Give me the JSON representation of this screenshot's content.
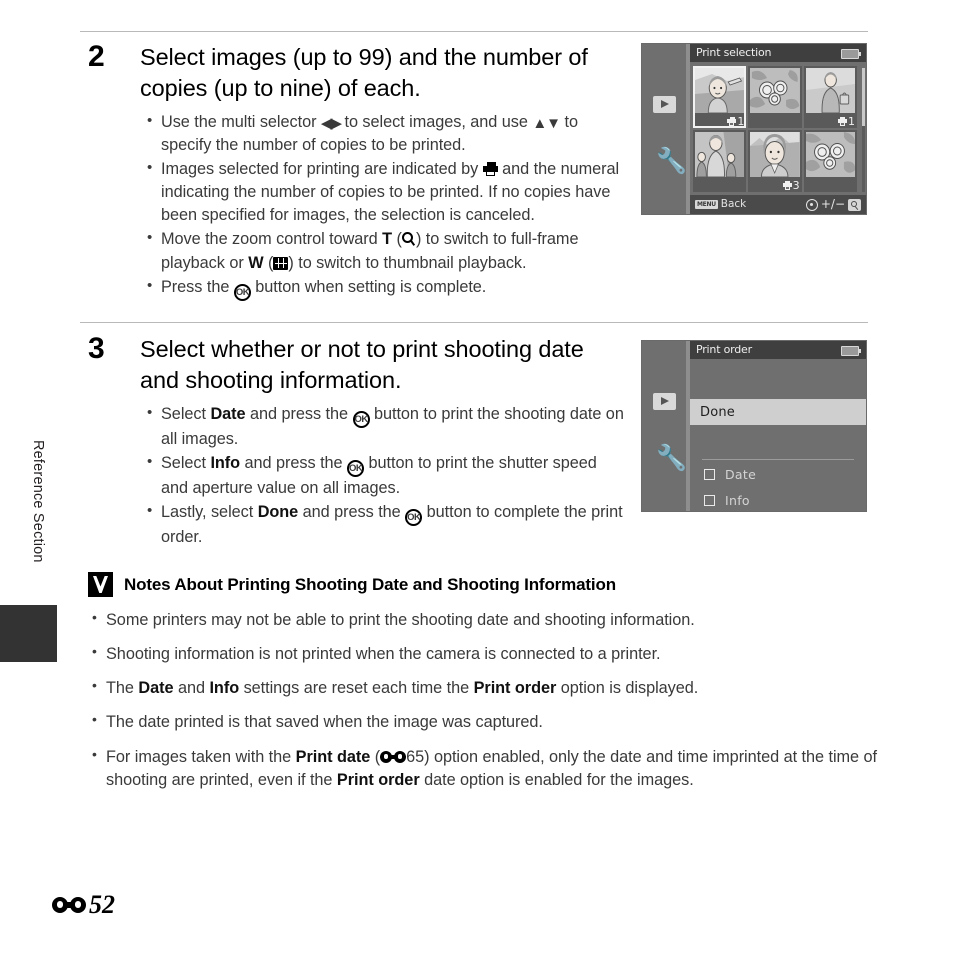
{
  "page": {
    "side_label": "Reference Section",
    "footer_page": "52"
  },
  "steps": [
    {
      "number": "2",
      "title": "Select images (up to 99) and the number of copies (up to nine) of each.",
      "bullets": [
        {
          "parts": [
            {
              "t": "text",
              "v": "Use the multi selector "
            },
            {
              "t": "icon",
              "v": "left-right-arrows-icon"
            },
            {
              "t": "text",
              "v": " to select images, and use "
            },
            {
              "t": "icon",
              "v": "up-down-arrows-icon"
            },
            {
              "t": "text",
              "v": " to specify the number of copies to be printed."
            }
          ]
        },
        {
          "parts": [
            {
              "t": "text",
              "v": "Images selected for printing are indicated by "
            },
            {
              "t": "icon",
              "v": "printer-icon"
            },
            {
              "t": "text",
              "v": " and the numeral indicating the number of copies to be printed. If no copies have been specified for images, the selection is canceled."
            }
          ]
        },
        {
          "parts": [
            {
              "t": "text",
              "v": "Move the zoom control toward "
            },
            {
              "t": "bold",
              "v": "T"
            },
            {
              "t": "text",
              "v": " ("
            },
            {
              "t": "icon",
              "v": "magnifier-icon"
            },
            {
              "t": "text",
              "v": ") to switch to full-frame playback or "
            },
            {
              "t": "bold",
              "v": "W"
            },
            {
              "t": "text",
              "v": " ("
            },
            {
              "t": "icon",
              "v": "thumbnail-grid-icon"
            },
            {
              "t": "text",
              "v": ") to switch to thumbnail playback."
            }
          ]
        },
        {
          "parts": [
            {
              "t": "text",
              "v": "Press the "
            },
            {
              "t": "icon",
              "v": "ok-button-icon"
            },
            {
              "t": "text",
              "v": " button when setting is complete."
            }
          ]
        }
      ]
    },
    {
      "number": "3",
      "title": "Select whether or not to print shooting date and shooting information.",
      "bullets": [
        {
          "parts": [
            {
              "t": "text",
              "v": "Select "
            },
            {
              "t": "bold",
              "v": "Date"
            },
            {
              "t": "text",
              "v": " and press the "
            },
            {
              "t": "icon",
              "v": "ok-button-icon"
            },
            {
              "t": "text",
              "v": " button to print the shooting date on all images."
            }
          ]
        },
        {
          "parts": [
            {
              "t": "text",
              "v": "Select "
            },
            {
              "t": "bold",
              "v": "Info"
            },
            {
              "t": "text",
              "v": " and press the "
            },
            {
              "t": "icon",
              "v": "ok-button-icon"
            },
            {
              "t": "text",
              "v": " button to print the shutter speed and aperture value on all images."
            }
          ]
        },
        {
          "parts": [
            {
              "t": "text",
              "v": "Lastly, select "
            },
            {
              "t": "bold",
              "v": "Done"
            },
            {
              "t": "text",
              "v": " and press the "
            },
            {
              "t": "icon",
              "v": "ok-button-icon"
            },
            {
              "t": "text",
              "v": " button to complete the print order."
            }
          ]
        }
      ]
    }
  ],
  "notes": {
    "icon": "warning-checkmark-icon",
    "title": "Notes About Printing Shooting Date and Shooting Information",
    "items": [
      {
        "parts": [
          {
            "t": "text",
            "v": "Some printers may not be able to print the shooting date and shooting information."
          }
        ]
      },
      {
        "parts": [
          {
            "t": "text",
            "v": "Shooting information is not printed when the camera is connected to a printer."
          }
        ]
      },
      {
        "parts": [
          {
            "t": "text",
            "v": "The "
          },
          {
            "t": "bold",
            "v": "Date"
          },
          {
            "t": "text",
            "v": " and "
          },
          {
            "t": "bold",
            "v": "Info"
          },
          {
            "t": "text",
            "v": " settings are reset each time the "
          },
          {
            "t": "bold",
            "v": "Print order"
          },
          {
            "t": "text",
            "v": " option is displayed."
          }
        ]
      },
      {
        "parts": [
          {
            "t": "text",
            "v": "The date printed is that saved when the image was captured."
          }
        ]
      },
      {
        "parts": [
          {
            "t": "text",
            "v": "For images taken with the "
          },
          {
            "t": "bold",
            "v": "Print date"
          },
          {
            "t": "text",
            "v": " ("
          },
          {
            "t": "icon",
            "v": "reference-section-icon"
          },
          {
            "t": "text",
            "v": "65) option enabled, only the date and time imprinted at the time of shooting are printed, even if the "
          },
          {
            "t": "bold",
            "v": "Print order"
          },
          {
            "t": "text",
            "v": " date option is enabled for the images."
          }
        ]
      }
    ]
  },
  "screens": {
    "print_selection": {
      "title": "Print selection",
      "battery_icon": "battery-icon",
      "rail": {
        "playback_icon": "playback-mode-icon",
        "setup_icon": "wrench-setup-icon"
      },
      "thumbnails": [
        {
          "id": 1,
          "selected": true,
          "count": "1",
          "scene": "woman-beach"
        },
        {
          "id": 2,
          "selected": false,
          "count": "",
          "scene": "flowers"
        },
        {
          "id": 3,
          "selected": false,
          "count": "1",
          "scene": "woman-bag"
        },
        {
          "id": 4,
          "selected": false,
          "count": "",
          "scene": "family"
        },
        {
          "id": 5,
          "selected": false,
          "count": "3",
          "scene": "portrait"
        },
        {
          "id": 6,
          "selected": false,
          "count": "",
          "scene": "flowers"
        }
      ],
      "footer": {
        "menu_key": "MENU",
        "back_label": "Back",
        "multiselector_icon": "multi-selector-icon",
        "plus_minus": "+/−",
        "zoom_icon": "magnifier-button-icon"
      }
    },
    "print_order": {
      "title": "Print order",
      "battery_icon": "battery-icon",
      "rail": {
        "playback_icon": "playback-mode-icon",
        "setup_icon": "wrench-setup-icon"
      },
      "selected_item": "Done",
      "options": [
        {
          "label": "Date",
          "checked": false
        },
        {
          "label": "Info",
          "checked": false
        }
      ]
    }
  }
}
